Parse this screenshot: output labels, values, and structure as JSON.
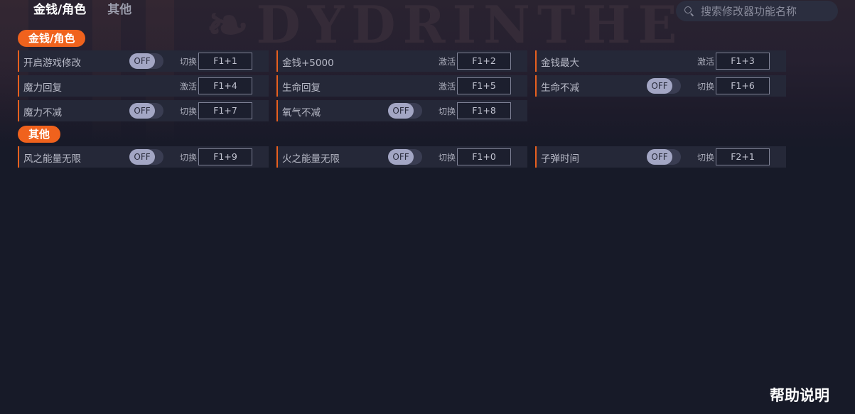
{
  "tabs": [
    {
      "label": "金钱/角色"
    },
    {
      "label": "其他"
    }
  ],
  "search": {
    "placeholder": "搜索修改器功能名称"
  },
  "sections": [
    {
      "title": "金钱/角色"
    },
    {
      "title": "其他"
    }
  ],
  "items": [
    {
      "name": "开启游戏修改",
      "mode": "切换",
      "toggle": "OFF",
      "hotkey": "F1+1"
    },
    {
      "name": "金钱+5000",
      "mode": "激活",
      "hotkey": "F1+2"
    },
    {
      "name": "金钱最大",
      "mode": "激活",
      "hotkey": "F1+3"
    },
    {
      "name": "魔力回复",
      "mode": "激活",
      "hotkey": "F1+4"
    },
    {
      "name": "生命回复",
      "mode": "激活",
      "hotkey": "F1+5"
    },
    {
      "name": "生命不减",
      "mode": "切换",
      "toggle": "OFF",
      "hotkey": "F1+6"
    },
    {
      "name": "魔力不减",
      "mode": "切换",
      "toggle": "OFF",
      "hotkey": "F1+7"
    },
    {
      "name": "氧气不减",
      "mode": "切换",
      "toggle": "OFF",
      "hotkey": "F1+8"
    },
    {
      "name": "风之能量无限",
      "mode": "切换",
      "toggle": "OFF",
      "hotkey": "F1+9"
    },
    {
      "name": "火之能量无限",
      "mode": "切换",
      "toggle": "OFF",
      "hotkey": "F1+0"
    },
    {
      "name": "子弹时间",
      "mode": "切换",
      "toggle": "OFF",
      "hotkey": "F2+1"
    }
  ],
  "help": {
    "label": "帮助说明"
  },
  "colors": {
    "accent": "#f0621d",
    "background": "#171a28",
    "row": "#252838"
  }
}
